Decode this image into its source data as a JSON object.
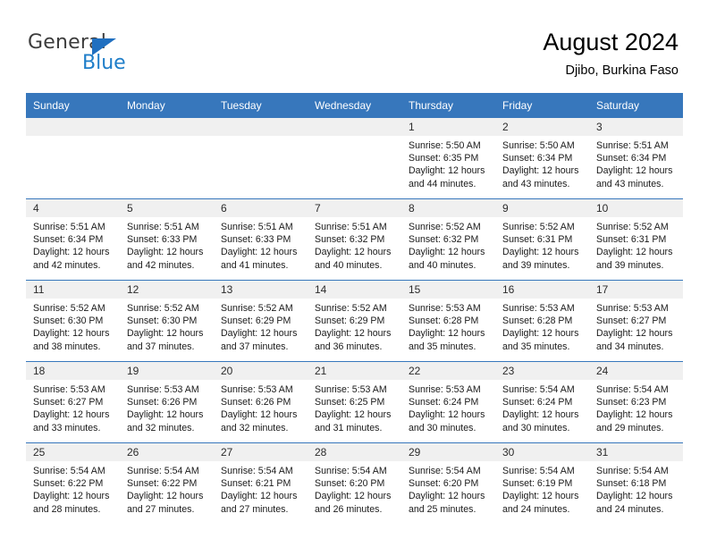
{
  "brand": {
    "name_top": "General",
    "name_bottom": "Blue",
    "triangle_color": "#1f6fc0",
    "text_color": "#3c3c3c",
    "blue_color": "#1f7ec9"
  },
  "header": {
    "title": "August 2024",
    "subtitle": "Djibo, Burkina Faso"
  },
  "theme": {
    "header_bg": "#3777bc",
    "header_text": "#ffffff",
    "daynum_bg": "#f0f0f0",
    "row_divider": "#3777bc"
  },
  "columns": [
    "Sunday",
    "Monday",
    "Tuesday",
    "Wednesday",
    "Thursday",
    "Friday",
    "Saturday"
  ],
  "labels": {
    "sunrise": "Sunrise:",
    "sunset": "Sunset:",
    "daylight": "Daylight:"
  },
  "weeks": [
    [
      {
        "day": "",
        "blank": true
      },
      {
        "day": "",
        "blank": true
      },
      {
        "day": "",
        "blank": true
      },
      {
        "day": "",
        "blank": true
      },
      {
        "day": "1",
        "sunrise": "Sunrise: 5:50 AM",
        "sunset": "Sunset: 6:35 PM",
        "daylight1": "Daylight: 12 hours",
        "daylight2": "and 44 minutes."
      },
      {
        "day": "2",
        "sunrise": "Sunrise: 5:50 AM",
        "sunset": "Sunset: 6:34 PM",
        "daylight1": "Daylight: 12 hours",
        "daylight2": "and 43 minutes."
      },
      {
        "day": "3",
        "sunrise": "Sunrise: 5:51 AM",
        "sunset": "Sunset: 6:34 PM",
        "daylight1": "Daylight: 12 hours",
        "daylight2": "and 43 minutes."
      }
    ],
    [
      {
        "day": "4",
        "sunrise": "Sunrise: 5:51 AM",
        "sunset": "Sunset: 6:34 PM",
        "daylight1": "Daylight: 12 hours",
        "daylight2": "and 42 minutes."
      },
      {
        "day": "5",
        "sunrise": "Sunrise: 5:51 AM",
        "sunset": "Sunset: 6:33 PM",
        "daylight1": "Daylight: 12 hours",
        "daylight2": "and 42 minutes."
      },
      {
        "day": "6",
        "sunrise": "Sunrise: 5:51 AM",
        "sunset": "Sunset: 6:33 PM",
        "daylight1": "Daylight: 12 hours",
        "daylight2": "and 41 minutes."
      },
      {
        "day": "7",
        "sunrise": "Sunrise: 5:51 AM",
        "sunset": "Sunset: 6:32 PM",
        "daylight1": "Daylight: 12 hours",
        "daylight2": "and 40 minutes."
      },
      {
        "day": "8",
        "sunrise": "Sunrise: 5:52 AM",
        "sunset": "Sunset: 6:32 PM",
        "daylight1": "Daylight: 12 hours",
        "daylight2": "and 40 minutes."
      },
      {
        "day": "9",
        "sunrise": "Sunrise: 5:52 AM",
        "sunset": "Sunset: 6:31 PM",
        "daylight1": "Daylight: 12 hours",
        "daylight2": "and 39 minutes."
      },
      {
        "day": "10",
        "sunrise": "Sunrise: 5:52 AM",
        "sunset": "Sunset: 6:31 PM",
        "daylight1": "Daylight: 12 hours",
        "daylight2": "and 39 minutes."
      }
    ],
    [
      {
        "day": "11",
        "sunrise": "Sunrise: 5:52 AM",
        "sunset": "Sunset: 6:30 PM",
        "daylight1": "Daylight: 12 hours",
        "daylight2": "and 38 minutes."
      },
      {
        "day": "12",
        "sunrise": "Sunrise: 5:52 AM",
        "sunset": "Sunset: 6:30 PM",
        "daylight1": "Daylight: 12 hours",
        "daylight2": "and 37 minutes."
      },
      {
        "day": "13",
        "sunrise": "Sunrise: 5:52 AM",
        "sunset": "Sunset: 6:29 PM",
        "daylight1": "Daylight: 12 hours",
        "daylight2": "and 37 minutes."
      },
      {
        "day": "14",
        "sunrise": "Sunrise: 5:52 AM",
        "sunset": "Sunset: 6:29 PM",
        "daylight1": "Daylight: 12 hours",
        "daylight2": "and 36 minutes."
      },
      {
        "day": "15",
        "sunrise": "Sunrise: 5:53 AM",
        "sunset": "Sunset: 6:28 PM",
        "daylight1": "Daylight: 12 hours",
        "daylight2": "and 35 minutes."
      },
      {
        "day": "16",
        "sunrise": "Sunrise: 5:53 AM",
        "sunset": "Sunset: 6:28 PM",
        "daylight1": "Daylight: 12 hours",
        "daylight2": "and 35 minutes."
      },
      {
        "day": "17",
        "sunrise": "Sunrise: 5:53 AM",
        "sunset": "Sunset: 6:27 PM",
        "daylight1": "Daylight: 12 hours",
        "daylight2": "and 34 minutes."
      }
    ],
    [
      {
        "day": "18",
        "sunrise": "Sunrise: 5:53 AM",
        "sunset": "Sunset: 6:27 PM",
        "daylight1": "Daylight: 12 hours",
        "daylight2": "and 33 minutes."
      },
      {
        "day": "19",
        "sunrise": "Sunrise: 5:53 AM",
        "sunset": "Sunset: 6:26 PM",
        "daylight1": "Daylight: 12 hours",
        "daylight2": "and 32 minutes."
      },
      {
        "day": "20",
        "sunrise": "Sunrise: 5:53 AM",
        "sunset": "Sunset: 6:26 PM",
        "daylight1": "Daylight: 12 hours",
        "daylight2": "and 32 minutes."
      },
      {
        "day": "21",
        "sunrise": "Sunrise: 5:53 AM",
        "sunset": "Sunset: 6:25 PM",
        "daylight1": "Daylight: 12 hours",
        "daylight2": "and 31 minutes."
      },
      {
        "day": "22",
        "sunrise": "Sunrise: 5:53 AM",
        "sunset": "Sunset: 6:24 PM",
        "daylight1": "Daylight: 12 hours",
        "daylight2": "and 30 minutes."
      },
      {
        "day": "23",
        "sunrise": "Sunrise: 5:54 AM",
        "sunset": "Sunset: 6:24 PM",
        "daylight1": "Daylight: 12 hours",
        "daylight2": "and 30 minutes."
      },
      {
        "day": "24",
        "sunrise": "Sunrise: 5:54 AM",
        "sunset": "Sunset: 6:23 PM",
        "daylight1": "Daylight: 12 hours",
        "daylight2": "and 29 minutes."
      }
    ],
    [
      {
        "day": "25",
        "sunrise": "Sunrise: 5:54 AM",
        "sunset": "Sunset: 6:22 PM",
        "daylight1": "Daylight: 12 hours",
        "daylight2": "and 28 minutes."
      },
      {
        "day": "26",
        "sunrise": "Sunrise: 5:54 AM",
        "sunset": "Sunset: 6:22 PM",
        "daylight1": "Daylight: 12 hours",
        "daylight2": "and 27 minutes."
      },
      {
        "day": "27",
        "sunrise": "Sunrise: 5:54 AM",
        "sunset": "Sunset: 6:21 PM",
        "daylight1": "Daylight: 12 hours",
        "daylight2": "and 27 minutes."
      },
      {
        "day": "28",
        "sunrise": "Sunrise: 5:54 AM",
        "sunset": "Sunset: 6:20 PM",
        "daylight1": "Daylight: 12 hours",
        "daylight2": "and 26 minutes."
      },
      {
        "day": "29",
        "sunrise": "Sunrise: 5:54 AM",
        "sunset": "Sunset: 6:20 PM",
        "daylight1": "Daylight: 12 hours",
        "daylight2": "and 25 minutes."
      },
      {
        "day": "30",
        "sunrise": "Sunrise: 5:54 AM",
        "sunset": "Sunset: 6:19 PM",
        "daylight1": "Daylight: 12 hours",
        "daylight2": "and 24 minutes."
      },
      {
        "day": "31",
        "sunrise": "Sunrise: 5:54 AM",
        "sunset": "Sunset: 6:18 PM",
        "daylight1": "Daylight: 12 hours",
        "daylight2": "and 24 minutes."
      }
    ]
  ]
}
